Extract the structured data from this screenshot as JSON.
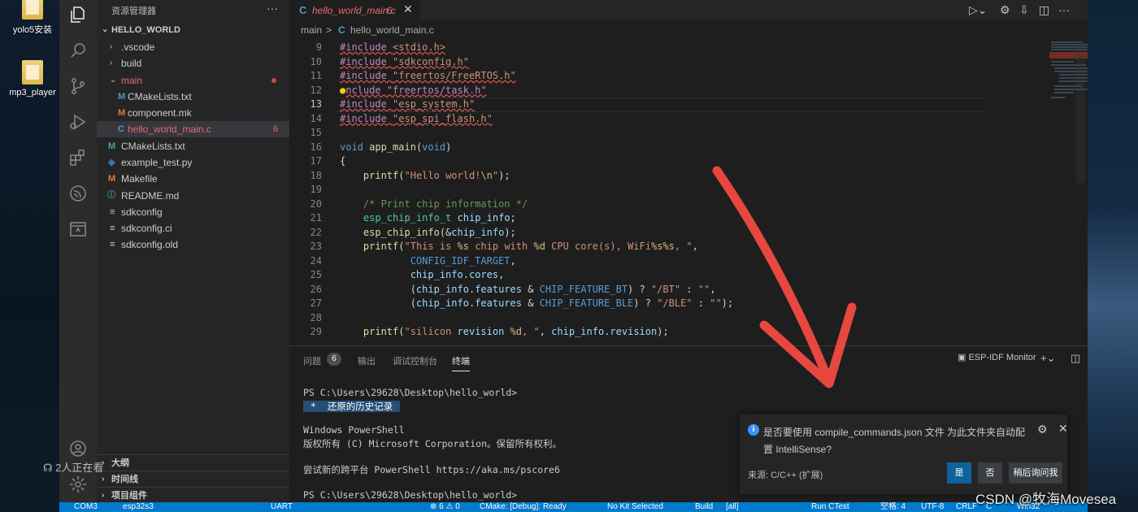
{
  "desktop": {
    "icons": [
      {
        "label": "yolo5安装"
      },
      {
        "label": "mp3_player"
      }
    ]
  },
  "sidebar": {
    "title": "资源管理器",
    "more": "···",
    "root": "HELLO_WORLD",
    "tree": [
      {
        "name": ".vscode",
        "kind": "folder",
        "expanded": false
      },
      {
        "name": "build",
        "kind": "folder",
        "expanded": false
      },
      {
        "name": "main",
        "kind": "folder",
        "expanded": true,
        "status": "modified"
      },
      {
        "name": "CMakeLists.txt",
        "icon": "M",
        "indent": 1
      },
      {
        "name": "component.mk",
        "icon": "M",
        "indent": 1
      },
      {
        "name": "hello_world_main.c",
        "icon": "C",
        "indent": 1,
        "badge": "6",
        "active": true
      },
      {
        "name": "CMakeLists.txt",
        "icon": "M"
      },
      {
        "name": "example_test.py",
        "icon": "py"
      },
      {
        "name": "Makefile",
        "icon": "M"
      },
      {
        "name": "README.md",
        "icon": "i"
      },
      {
        "name": "sdkconfig",
        "icon": "≡"
      },
      {
        "name": "sdkconfig.ci",
        "icon": "≡"
      },
      {
        "name": "sdkconfig.old",
        "icon": "≡"
      }
    ],
    "sections": [
      "大纲",
      "时间线",
      "项目组件"
    ]
  },
  "editor": {
    "tab": {
      "icon": "C",
      "name": "hello_world_main.c",
      "problems": "6",
      "close": "✕"
    },
    "breadcrumb": {
      "folder": "main",
      "sep": ">",
      "icon": "C",
      "file": "hello_world_main.c"
    },
    "current_line": "13",
    "lines": [
      {
        "n": "9",
        "text": "#include <stdio.h>"
      },
      {
        "n": "10",
        "text": "#include \"sdkconfig.h\""
      },
      {
        "n": "11",
        "text": "#include \"freertos/FreeRTOS.h\""
      },
      {
        "n": "12",
        "text": "nclude \"freertos/task.h\""
      },
      {
        "n": "13",
        "text": "#include \"esp_system.h\""
      },
      {
        "n": "14",
        "text": "#include \"esp_spi_flash.h\""
      },
      {
        "n": "15",
        "text": ""
      },
      {
        "n": "16",
        "text": "void app_main(void)"
      },
      {
        "n": "17",
        "text": "{"
      },
      {
        "n": "18",
        "text": "    printf(\"Hello world!\\n\");"
      },
      {
        "n": "19",
        "text": ""
      },
      {
        "n": "20",
        "text": "    /* Print chip information */"
      },
      {
        "n": "21",
        "text": "    esp_chip_info_t chip_info;"
      },
      {
        "n": "22",
        "text": "    esp_chip_info(&chip_info);"
      },
      {
        "n": "23",
        "text": "    printf(\"This is %s chip with %d CPU core(s), WiFi%s%s, \","
      },
      {
        "n": "24",
        "text": "            CONFIG_IDF_TARGET,"
      },
      {
        "n": "25",
        "text": "            chip_info.cores,"
      },
      {
        "n": "26",
        "text": "            (chip_info.features & CHIP_FEATURE_BT) ? \"/BT\" : \"\","
      },
      {
        "n": "27",
        "text": "            (chip_info.features & CHIP_FEATURE_BLE) ? \"/BLE\" : \"\");"
      },
      {
        "n": "28",
        "text": ""
      },
      {
        "n": "29",
        "text": "    printf(\"silicon revision %d, \", chip_info.revision);"
      }
    ]
  },
  "panel": {
    "tabs": [
      {
        "label": "问题",
        "badge": "6"
      },
      {
        "label": "输出"
      },
      {
        "label": "调试控制台"
      },
      {
        "label": "终端",
        "active": true
      }
    ],
    "terminal_name": "ESP-IDF Monitor",
    "terminal": [
      "PS C:\\Users\\29628\\Desktop\\hello_world>",
      " *  还原的历史记录 ",
      "",
      "Windows PowerShell",
      "版权所有 (C) Microsoft Corporation。保留所有权利。",
      "",
      "尝试新的跨平台 PowerShell https://aka.ms/pscore6",
      "",
      "PS C:\\Users\\29628\\Desktop\\hello_world>"
    ]
  },
  "notification": {
    "message": "是否要使用 compile_commands.json 文件 为此文件夹自动配置 IntelliSense?",
    "source": "来源: C/C++ (扩展)",
    "buttons": [
      "是",
      "否",
      "稍后询问我"
    ]
  },
  "statusbar": {
    "items": [
      "COM3",
      "esp32s3",
      "UART",
      "⊗ 6 ⚠ 0",
      "CMake: [Debug]: Ready",
      "No Kit Selected",
      "Build",
      "[all]",
      "Run CTest",
      "空格: 4",
      "UTF-8",
      "CRLF",
      "C",
      "Win32"
    ]
  },
  "overlay": {
    "watchers": "2人正在看",
    "watermark": "CSDN @牧海Movesea"
  },
  "colors": {
    "accent": "#007acc",
    "error": "#e06c75",
    "annotation": "#e8473f"
  }
}
